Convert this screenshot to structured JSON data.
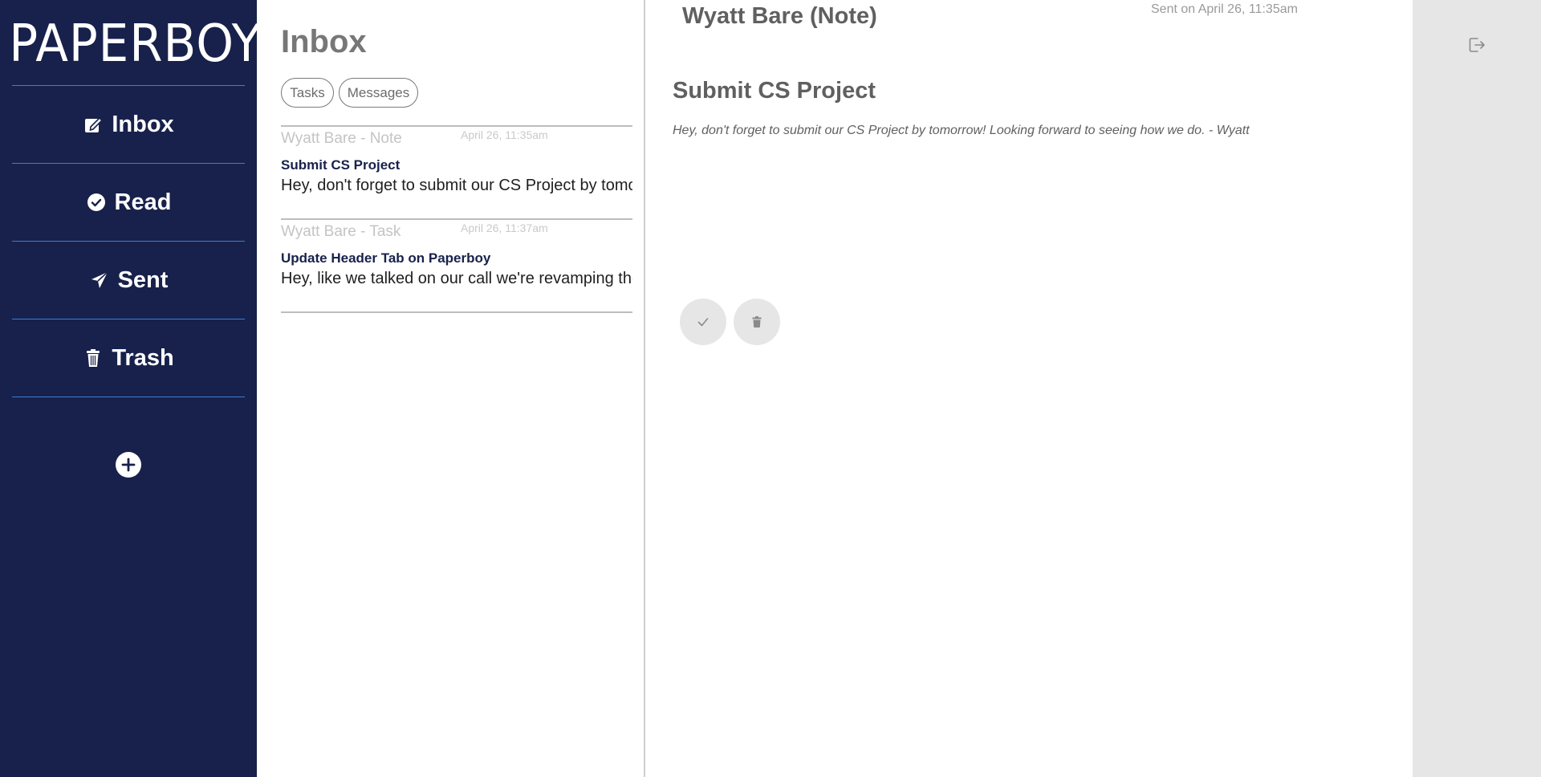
{
  "app": {
    "logo": "PAPERBOY"
  },
  "sidebar": {
    "items": [
      {
        "label": "Inbox",
        "icon": "edit-note-icon"
      },
      {
        "label": "Read",
        "icon": "check-circle-icon"
      },
      {
        "label": "Sent",
        "icon": "paper-plane-icon"
      },
      {
        "label": "Trash",
        "icon": "trash-icon"
      }
    ],
    "add_icon": "plus-circle-icon"
  },
  "list": {
    "title": "Inbox",
    "filters": [
      "Tasks",
      "Messages"
    ],
    "messages": [
      {
        "sender": "Wyatt Bare - Note",
        "date": "April 26, 11:35am",
        "subject": "Submit CS Project",
        "preview": "Hey, don't forget to submit our CS Project by tomorrow! Looking forward to seeing how we do. - Wyatt"
      },
      {
        "sender": "Wyatt Bare - Task",
        "date": "April 26, 11:37am",
        "subject": "Update Header Tab on Paperboy",
        "preview": "Hey, like we talked on our call we're revamping the header tab on Paperboy"
      }
    ]
  },
  "detail": {
    "sender": "Wyatt Bare (Note)",
    "sent": "Sent on April 26, 11:35am",
    "subject": "Submit CS Project",
    "body": "Hey, don't forget to submit our CS Project by tomorrow! Looking forward to seeing how we do. - Wyatt",
    "actions": [
      "check-icon",
      "trash-icon"
    ]
  },
  "rail": {
    "logout_icon": "logout-icon"
  },
  "colors": {
    "sidebar_bg": "#17214b",
    "divider_blue": "#3e7bd6",
    "rail_bg": "#e6e6e6"
  }
}
